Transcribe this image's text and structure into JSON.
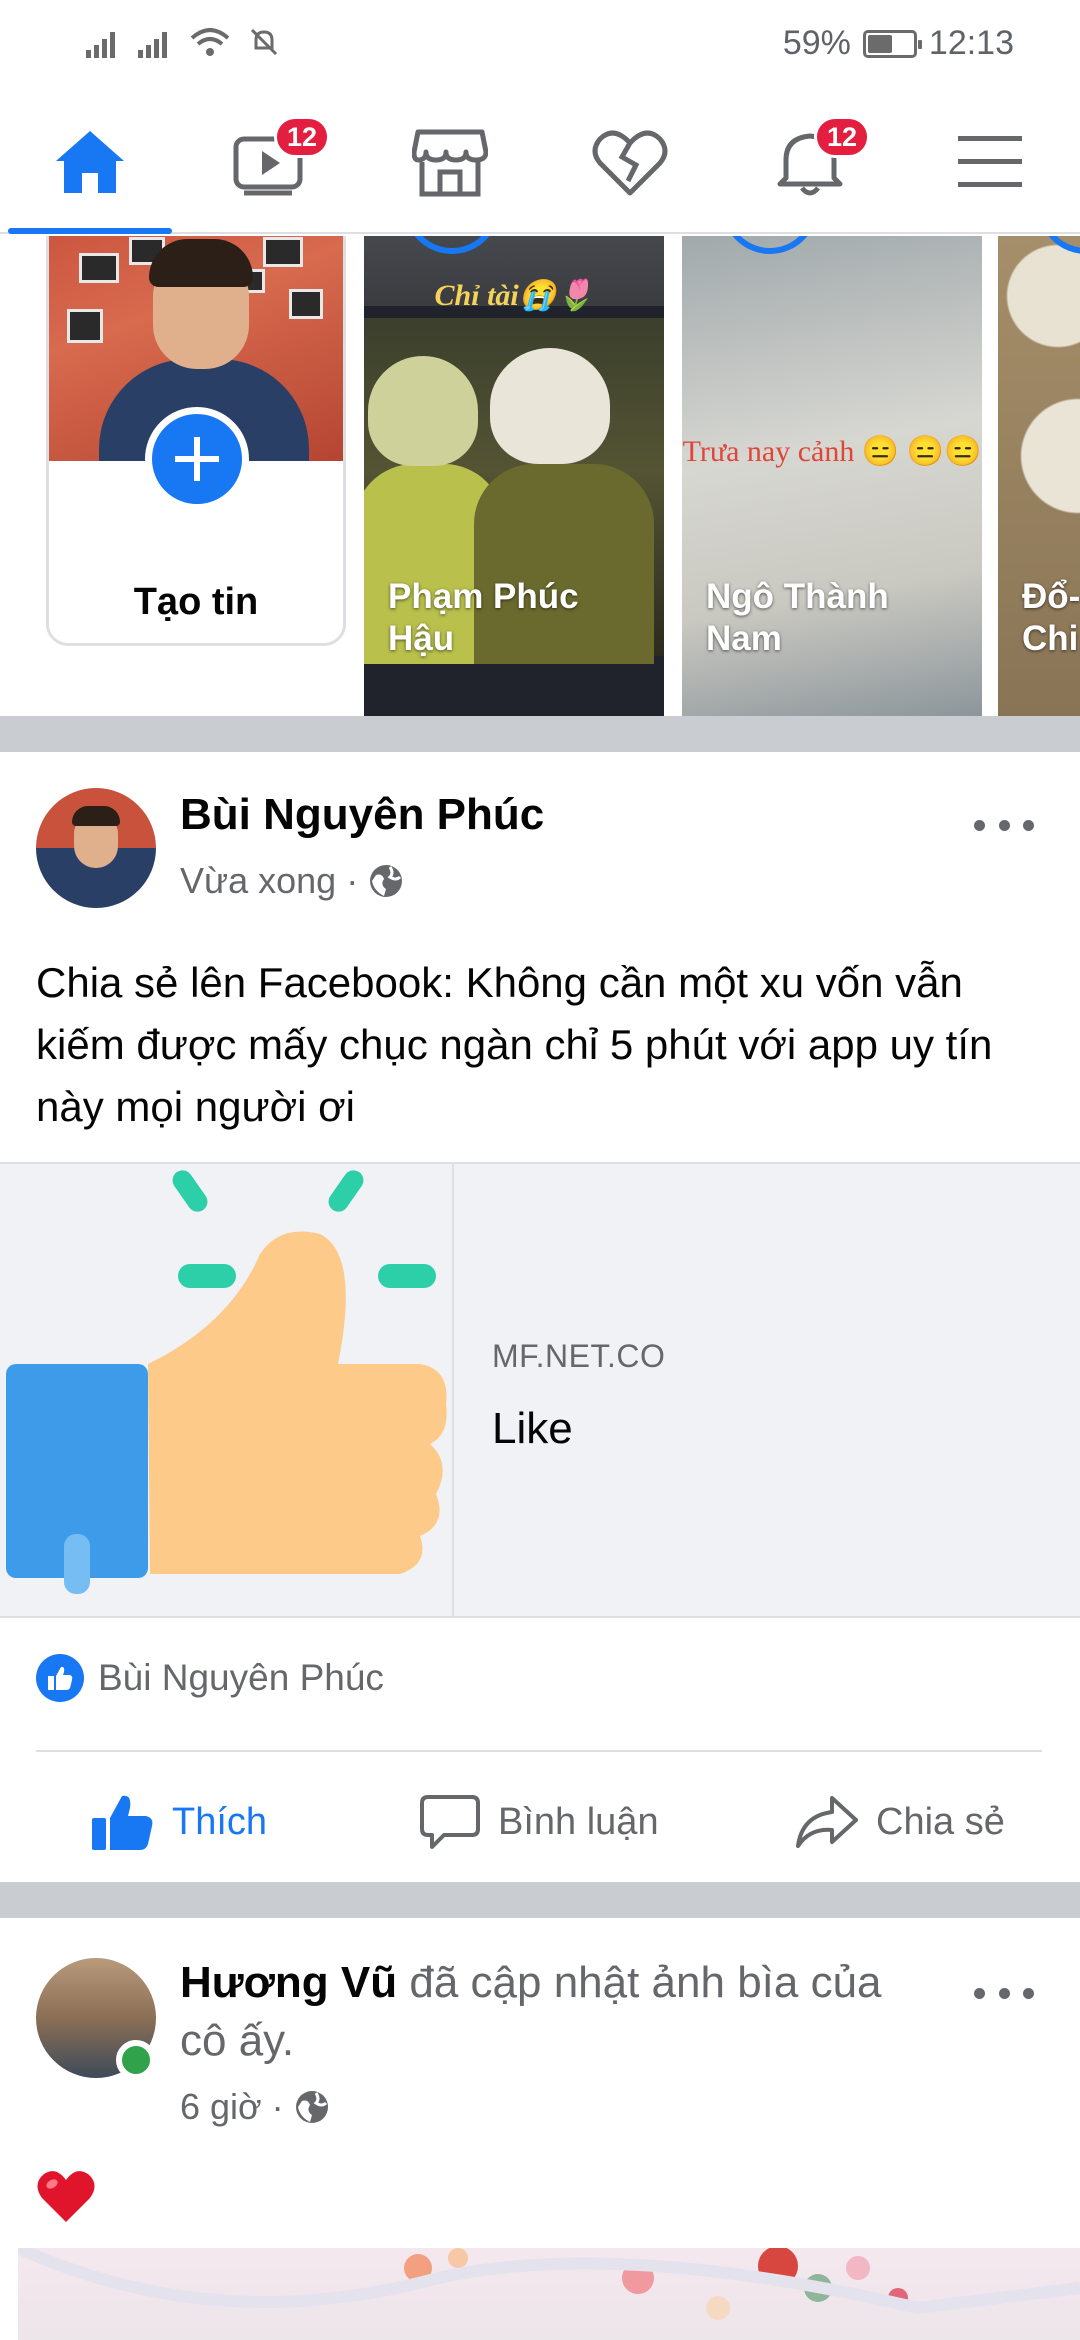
{
  "status_bar": {
    "battery": "59%",
    "battery_level": 0.59,
    "time": "12:13"
  },
  "nav": {
    "items": [
      {
        "name": "home",
        "icon": "home-icon",
        "active": true
      },
      {
        "name": "watch",
        "icon": "video-icon",
        "badge": "12"
      },
      {
        "name": "marketplace",
        "icon": "shop-icon"
      },
      {
        "name": "dating",
        "icon": "heart-icon"
      },
      {
        "name": "notifications",
        "icon": "bell-icon",
        "badge": "12"
      },
      {
        "name": "menu",
        "icon": "menu-icon"
      }
    ],
    "accent": "#1877f2",
    "badge_color": "#e41e3f"
  },
  "stories": {
    "create_label": "Tạo tin",
    "items": [
      {
        "name": "Phạm Phúc\nHậu",
        "caption": "Chỉ tài😭🌷"
      },
      {
        "name": "Ngô Thành\nNam",
        "caption": "Trưa nay cảnh 😑 😑😑"
      },
      {
        "name": "Đổ-\nChi",
        "caption": ""
      }
    ]
  },
  "post1": {
    "author": "Bùi Nguyên Phúc",
    "time": "Vừa xong",
    "privacy_icon": "globe-icon",
    "text": "Chia sẻ lên Facebook: Không cần một xu vốn vẫn kiếm được mấy chục ngàn chỉ 5 phút với app uy tín này mọi người ơi",
    "link": {
      "domain": "MF.NET.CO",
      "title": "Like",
      "thumbnail_icon": "thumbs-up-illustration"
    },
    "reactions_by": "Bùi Nguyên Phúc",
    "actions": {
      "like": "Thích",
      "comment": "Bình luận",
      "share": "Chia sẻ"
    }
  },
  "post2": {
    "author": "Hương Vũ",
    "action_text": "đã cập nhật ảnh bìa của cô ấy.",
    "time": "6 giờ",
    "privacy_icon": "globe-icon",
    "emoji": "❤️"
  }
}
